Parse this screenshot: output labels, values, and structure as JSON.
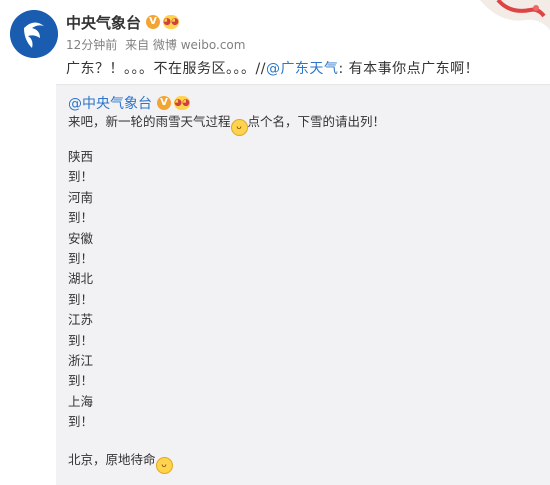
{
  "account": {
    "name": "中央气象台",
    "verified_badge": "V",
    "fan_badge_icon": "fan-face-badge-icon"
  },
  "meta": {
    "time": "12分钟前",
    "source": "来自 微博 weibo.com"
  },
  "post": {
    "text": "广东？！。。。不在服务区。。。//",
    "mention": "@广东天气",
    "reply": ": 有本事你点广东啊！"
  },
  "repost": {
    "author": "@中央气象台",
    "text_before": "来吧，新一轮的雨雪天气过程",
    "text_after": "点个名，下雪的请出列！",
    "lines": [
      "陕西",
      "到！",
      "河南",
      "到！",
      "安徽",
      "到！",
      "湖北",
      "到！",
      "江苏",
      "到！",
      "浙江",
      "到！",
      "上海",
      "到！"
    ],
    "closing": "北京，原地待命"
  },
  "colors": {
    "link": "#2d75c8",
    "repost_bg": "#f2f2f5",
    "avatar_bg": "#1a5db0",
    "badge": "#f3a533"
  }
}
